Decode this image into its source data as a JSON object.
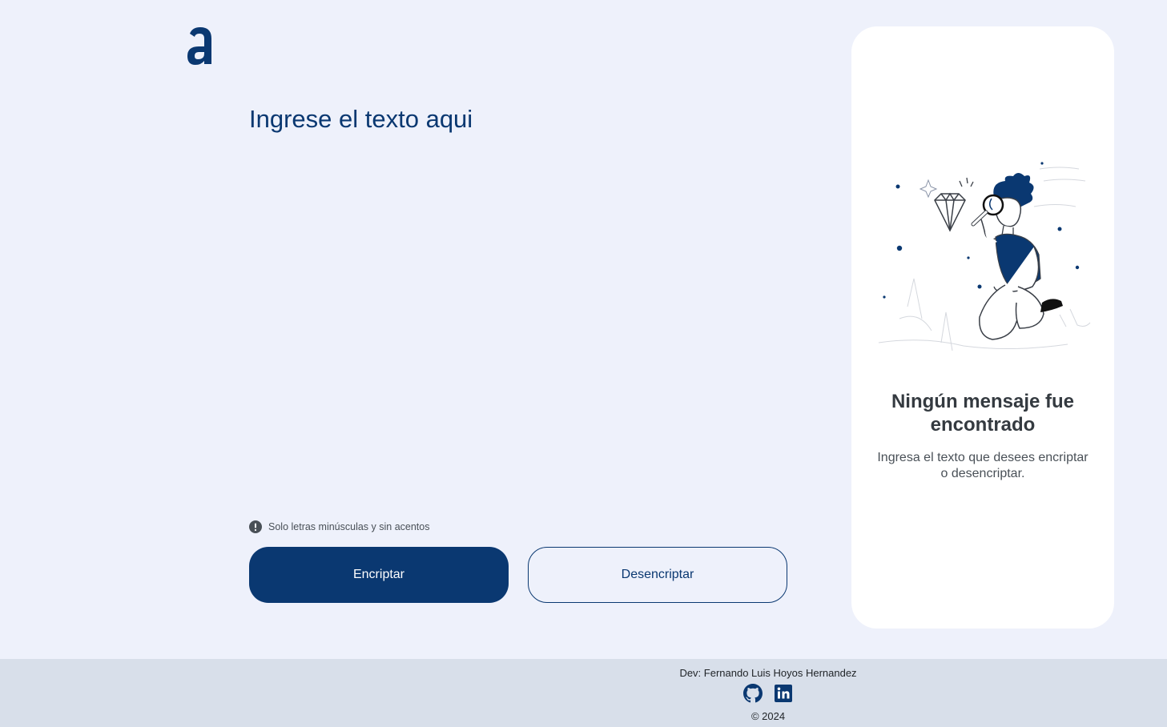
{
  "app": {
    "logo_icon": "alura-logo-icon"
  },
  "main": {
    "input_placeholder": "Ingrese el texto aqui",
    "input_value": "",
    "hint_text": "Solo letras minúsculas y sin acentos",
    "hint_icon": "exclamation-circle-icon",
    "encrypt_label": "Encriptar",
    "decrypt_label": "Desencriptar"
  },
  "result_panel": {
    "illustration": "person-with-magnifying-glass-illustration",
    "title": "Ningún mensaje fue encontrado",
    "text": "Ingresa el texto que desees encriptar o desencriptar."
  },
  "footer": {
    "dev_text": "Dev: Fernando Luis Hoyos Hernandez",
    "github_icon": "github-icon",
    "linkedin_icon": "linkedin-icon",
    "copyright": "© 2024"
  },
  "colors": {
    "background": "#eef1fb",
    "primary": "#0a3871",
    "card": "#ffffff",
    "footer": "#d8dfea"
  }
}
